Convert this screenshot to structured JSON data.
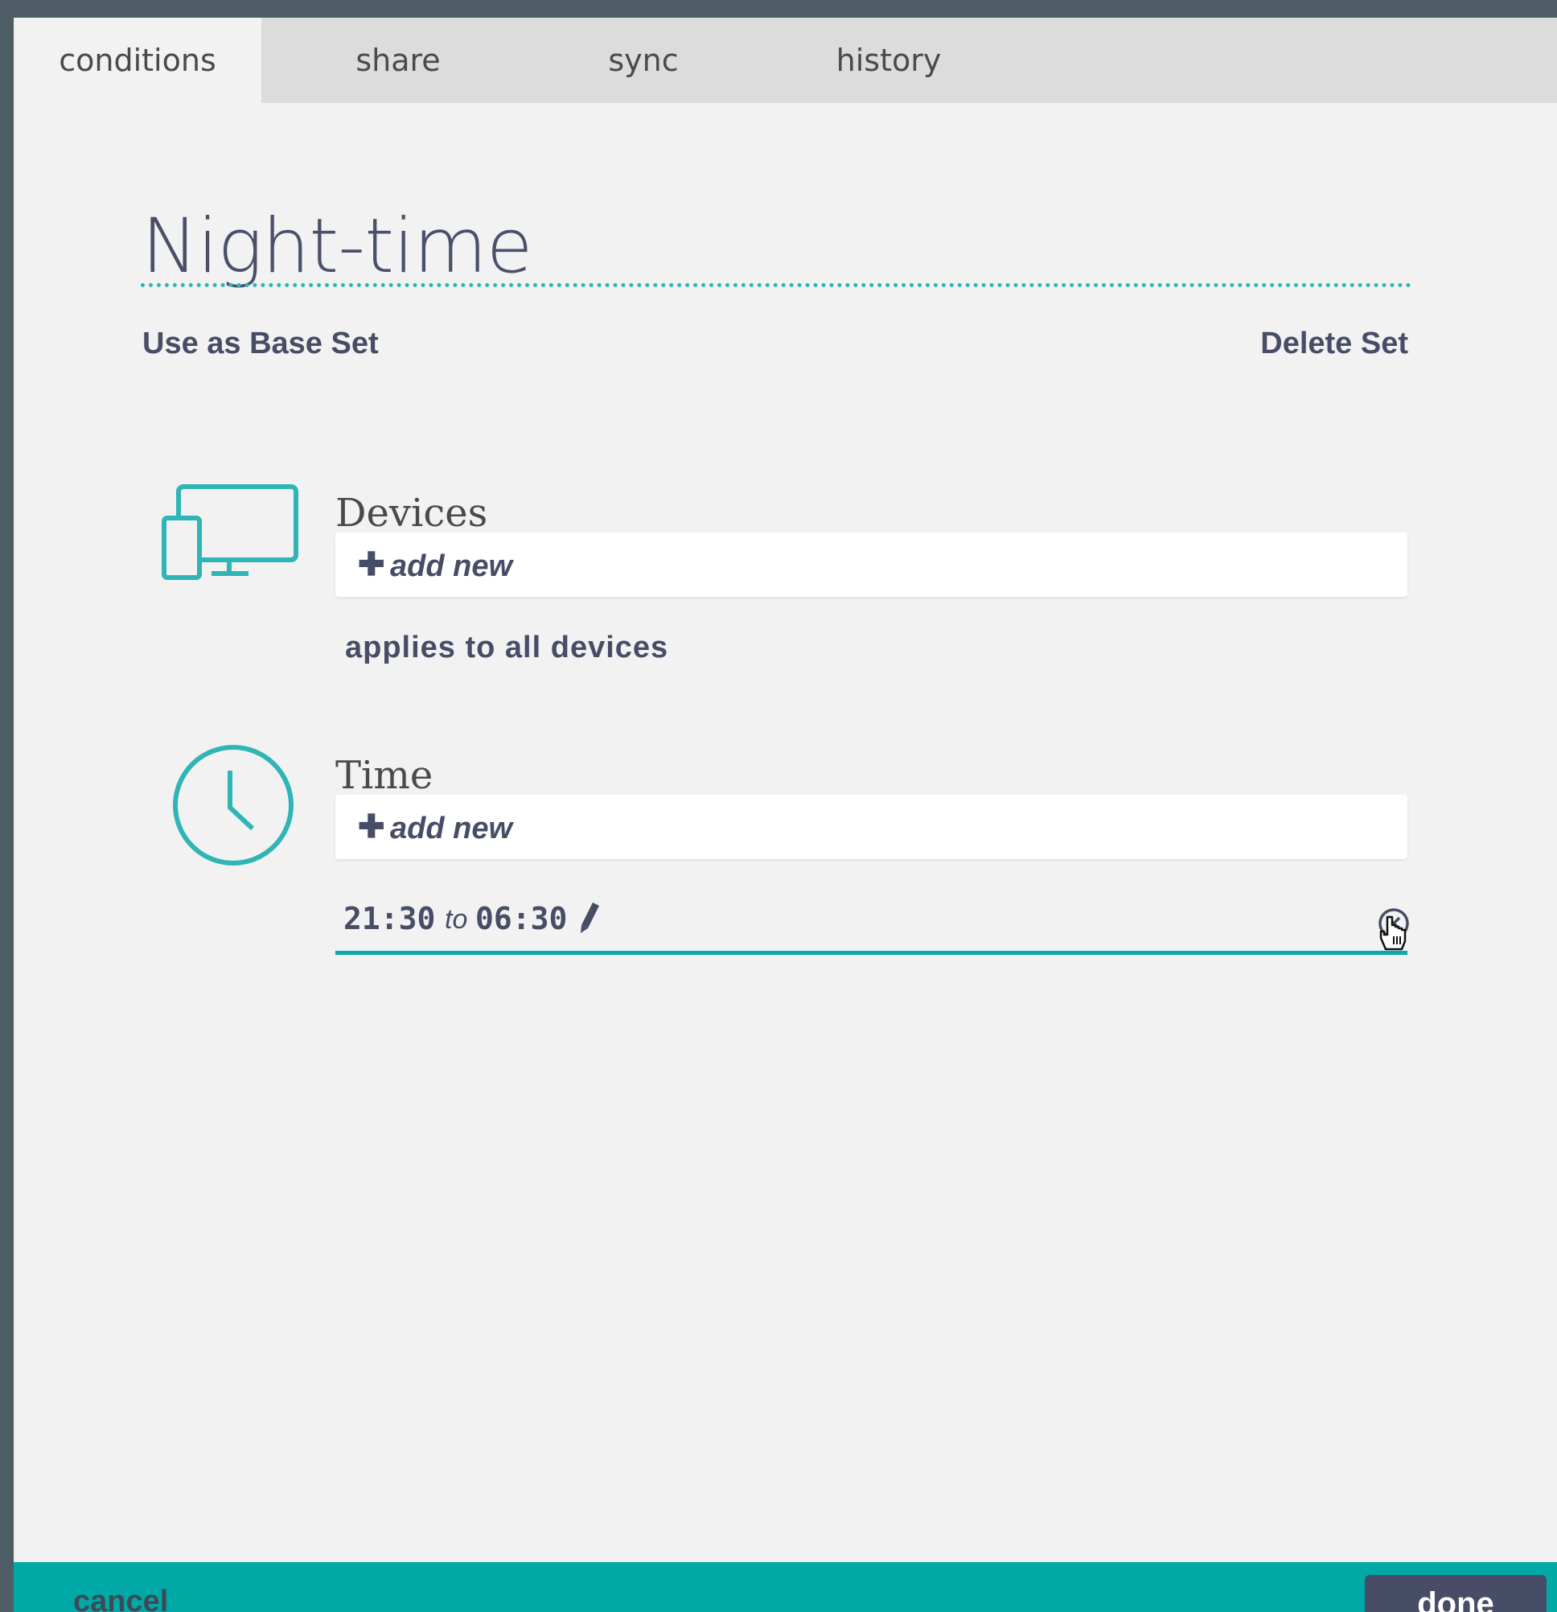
{
  "tabs": [
    {
      "label": "conditions",
      "active": true
    },
    {
      "label": "share",
      "active": false
    },
    {
      "label": "sync",
      "active": false
    },
    {
      "label": "history",
      "active": false
    }
  ],
  "set": {
    "name": "Night-time",
    "use_as_base_label": "Use as Base Set",
    "delete_label": "Delete Set"
  },
  "devices": {
    "heading": "Devices",
    "icon": "devices-icon",
    "add_label": "add new",
    "note": "applies to all devices"
  },
  "time": {
    "heading": "Time",
    "icon": "clock-icon",
    "add_label": "add new",
    "entries": [
      {
        "start": "21:30",
        "separator": "to",
        "end": "06:30"
      }
    ]
  },
  "footer": {
    "cancel_label": "cancel",
    "done_label": "done"
  },
  "colors": {
    "accent": "#2fb5b5",
    "footer": "#00a9a5",
    "text": "#474d66",
    "background": "#f2f2f2",
    "frame": "#4e5c66"
  }
}
